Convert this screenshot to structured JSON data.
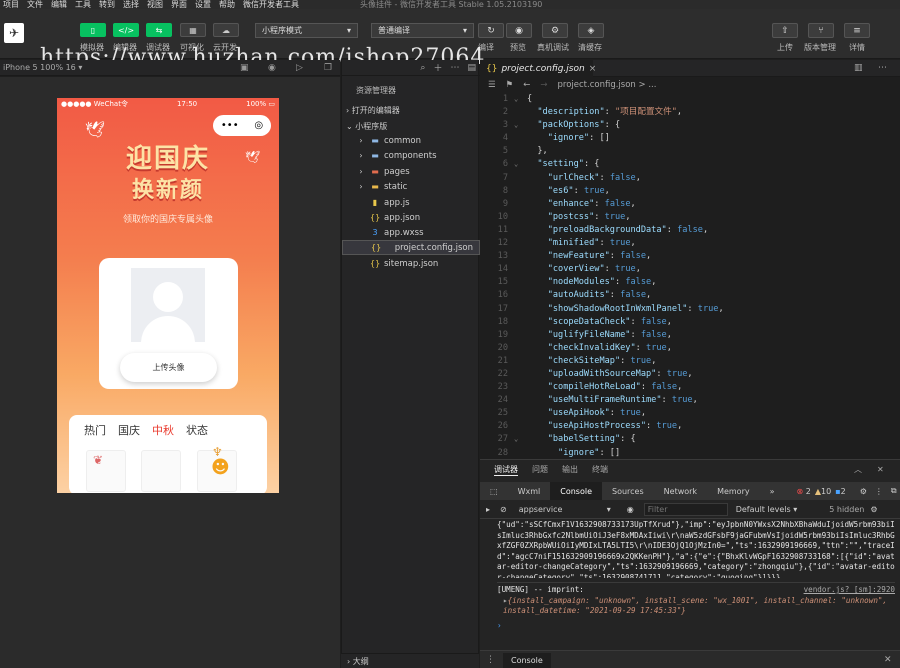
{
  "menubar": {
    "items": [
      "项目",
      "文件",
      "编辑",
      "工具",
      "转到",
      "选择",
      "视图",
      "界面",
      "设置",
      "帮助",
      "微信开发者工具"
    ],
    "window_title": "头像挂件 - 微信开发者工具 Stable 1.05.2103190"
  },
  "toolbar": {
    "left_labels": [
      "模拟器",
      "编辑器",
      "调试器",
      "可视化",
      "云开发"
    ],
    "mode_select": "小程序模式",
    "compile_select": "普通编译",
    "right_labels": [
      "编译",
      "预览",
      "真机调试",
      "清缓存"
    ],
    "far_right_labels": [
      "上传",
      "版本管理",
      "详情"
    ],
    "watermark": "https://www.huzhan.com/ishop27064"
  },
  "simulator": {
    "device": "iPhone 5 100% 16 ▾",
    "status_left": "●●●●● WeChat令",
    "status_time": "17:50",
    "status_right": "100% ▭",
    "hero_line1": "迎国庆",
    "hero_line2": "换新颜",
    "subtitle": "领取你的国庆专属头像",
    "upload_button": "上传头像",
    "tabs": [
      "热门",
      "国庆",
      "中秋",
      "状态"
    ],
    "active_tab": "中秋"
  },
  "explorer": {
    "title": "资源管理器",
    "section_open": "打开的编辑器",
    "section_project": "小程序版",
    "items": [
      {
        "name": "common",
        "kind": "folder"
      },
      {
        "name": "components",
        "kind": "folder"
      },
      {
        "name": "pages",
        "kind": "folder"
      },
      {
        "name": "static",
        "kind": "folder"
      },
      {
        "name": "app.js",
        "kind": "js"
      },
      {
        "name": "app.json",
        "kind": "json"
      },
      {
        "name": "app.wxss",
        "kind": "css"
      },
      {
        "name": "project.config.json",
        "kind": "json",
        "selected": true
      },
      {
        "name": "sitemap.json",
        "kind": "json"
      }
    ],
    "outline": "大纲"
  },
  "editor": {
    "tab_title": "project.config.json",
    "breadcrumb": "project.config.json > ...",
    "lines": [
      "{",
      "  \"description\": \"项目配置文件\",",
      "  \"packOptions\": {",
      "    \"ignore\": []",
      "  },",
      "  \"setting\": {",
      "    \"urlCheck\": false,",
      "    \"es6\": true,",
      "    \"enhance\": false,",
      "    \"postcss\": true,",
      "    \"preloadBackgroundData\": false,",
      "    \"minified\": true,",
      "    \"newFeature\": false,",
      "    \"coverView\": true,",
      "    \"nodeModules\": false,",
      "    \"autoAudits\": false,",
      "    \"showShadowRootInWxmlPanel\": true,",
      "    \"scopeDataCheck\": false,",
      "    \"uglifyFileName\": false,",
      "    \"checkInvalidKey\": true,",
      "    \"checkSiteMap\": true,",
      "    \"uploadWithSourceMap\": true,",
      "    \"compileHotReLoad\": false,",
      "    \"useMultiFrameRuntime\": true,",
      "    \"useApiHook\": true,",
      "    \"useApiHostProcess\": true,",
      "    \"babelSetting\": {",
      "      \"ignore\": []"
    ]
  },
  "devtools": {
    "top_tabs": [
      "调试器",
      "问题",
      "输出",
      "终端"
    ],
    "tabs": [
      "Wxml",
      "Console",
      "Sources",
      "Network",
      "Memory",
      "»"
    ],
    "active_tab": "Console",
    "errors": "2",
    "warnings": "10",
    "infos": "2",
    "context": "appservice",
    "filter_placeholder": "Filter",
    "levels": "Default levels ▾",
    "hidden": "5 hidden",
    "log_block": "{\"ud\":\"sSCfCmxF1V1632908733173UpTfXrud\"},\"imp\":\"eyJpbnN0YWxsX2NhbXBhaWduIjoidW5rbm93biIsImluc3RhbGxfc2NlbmUiOiJ3eF8xMDAxIiwi\\r\\naW5zdGFsbF9jaGFubmVsIjoidW5rbm93biIsImluc3RhbGxfZGF0ZXRpbWUiOiIyMDIxLTA5LTI5\\r\\nIDE3OjQ1OjMzIn0=\",\"ts\":1632909196669,\"ttn\":\"\",\"traceId\":\"agcC7niF151632909196669x2QKKenPH\"},\"a\":{\"e\":{\"BhxKlvWGpF1632908733168\":[{\"id\":\"avatar-editor-changeCategory\",\"ts\":1632909196669,\"category\":\"zhongqiu\"},{\"id\":\"avatar-editor-changeCategory\",\"ts\":1632908741711,\"category\":\"guoqing\"}]}}}",
    "umeng_line": "[UMENG] -- imprint:",
    "vendor_link": "vendor.js? [sm]:2920",
    "obj_line": "{install_campaign: \"unknown\", install_scene: \"wx_1001\", install_channel: \"unknown\", install_datetime: \"2021-09-29 17:45:33\"}",
    "bottom_tab": "Console"
  }
}
